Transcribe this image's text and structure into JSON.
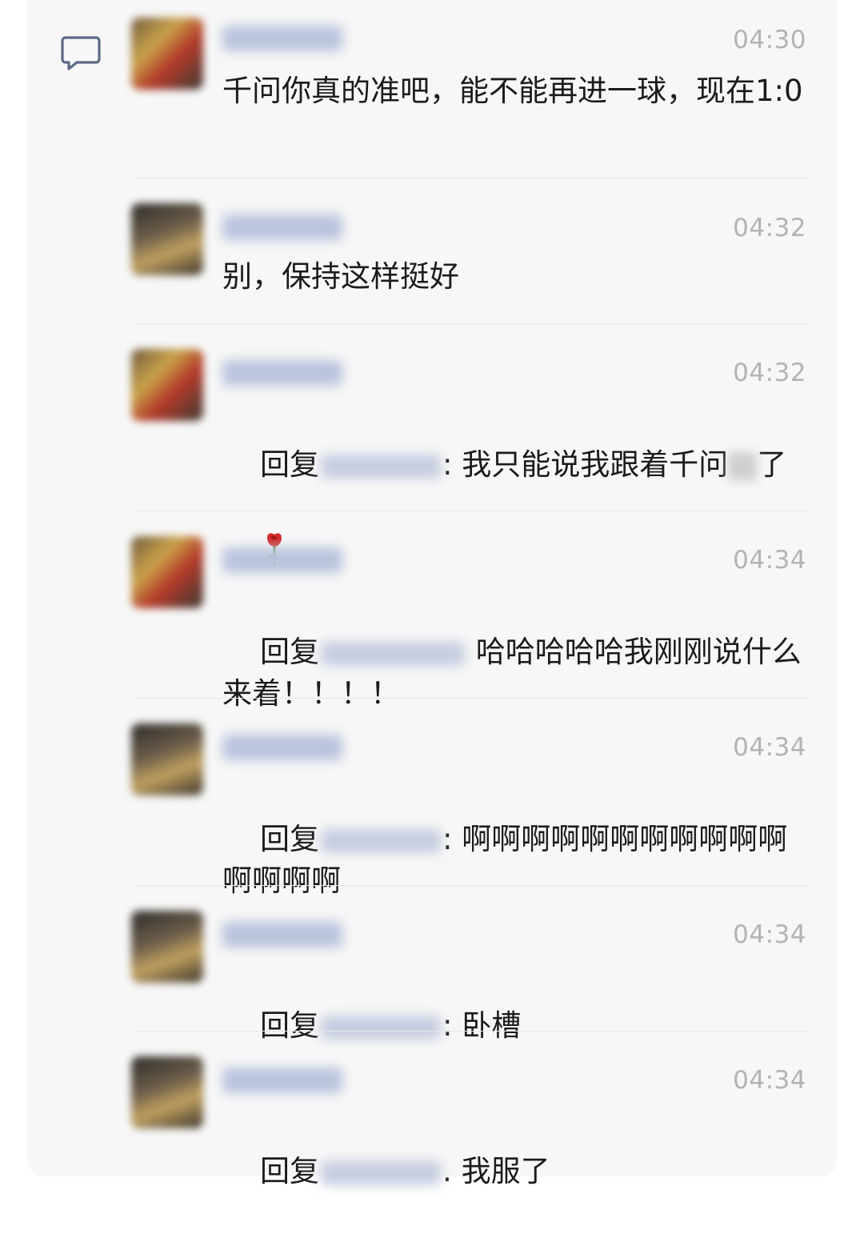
{
  "comments": [
    {
      "avatar": "a1",
      "time": "04:30",
      "text": "千问你真的准吧，能不能再进一球，现在1:0",
      "reply": false
    },
    {
      "avatar": "a2",
      "time": "04:32",
      "text": "别，保持这样挺好",
      "reply": false
    },
    {
      "avatar": "a1",
      "time": "04:32",
      "reply": true,
      "reply_prefix": "回复",
      "colon": ":",
      "text_before": " 我只能说我跟着千问",
      "text_after": "了",
      "emoji": "rose-icon"
    },
    {
      "avatar": "a1",
      "time": "04:34",
      "reply": true,
      "reply_prefix": "回复",
      "colon": "",
      "text_before": " 哈哈哈哈哈我刚刚说什么来着！！！！"
    },
    {
      "avatar": "a2",
      "time": "04:34",
      "reply": true,
      "reply_prefix": "回复",
      "colon": ":",
      "text_before": " 啊啊啊啊啊啊啊啊啊啊啊啊啊啊啊"
    },
    {
      "avatar": "a2",
      "time": "04:34",
      "reply": true,
      "reply_prefix": "回复",
      "colon": ":",
      "text_before": " 卧槽"
    },
    {
      "avatar": "a2",
      "time": "04:34",
      "reply": true,
      "reply_prefix": "回复",
      "colon": ".",
      "text_before": " 我服了"
    }
  ],
  "icons": {
    "comment": "comment-icon",
    "rose": "rose-icon"
  }
}
